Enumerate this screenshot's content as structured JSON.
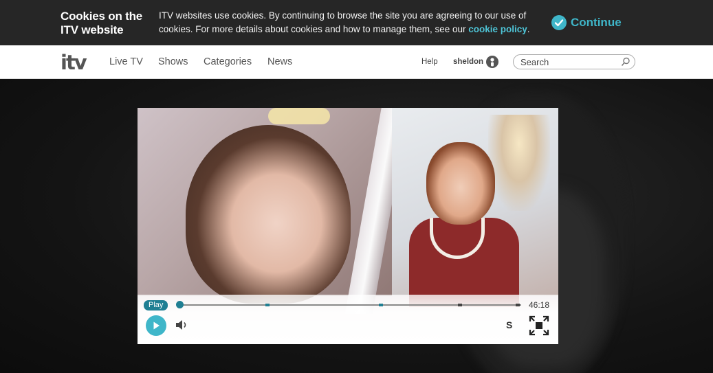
{
  "cookie_bar": {
    "title": "Cookies on the ITV website",
    "text": "ITV websites use cookies. By continuing to browse the site you are agreeing to our use of cookies. For more details about cookies and how to manage them, see our ",
    "link": "cookie policy",
    "end": ".",
    "continue_label": "Continue",
    "accent": "#3fb6c9"
  },
  "nav": {
    "logo": "itv",
    "links": [
      "Live TV",
      "Shows",
      "Categories",
      "News"
    ],
    "help": "Help",
    "user": "sheldon",
    "search_placeholder": "Search",
    "icons": [
      "user-icon",
      "search-icon"
    ]
  },
  "player": {
    "play_badge": "Play",
    "duration": "46:18",
    "progress": 0,
    "subtitles_label": "S",
    "icons": [
      "play-icon",
      "volume-icon",
      "fullscreen-icon"
    ],
    "accent": "#1f7f93"
  }
}
